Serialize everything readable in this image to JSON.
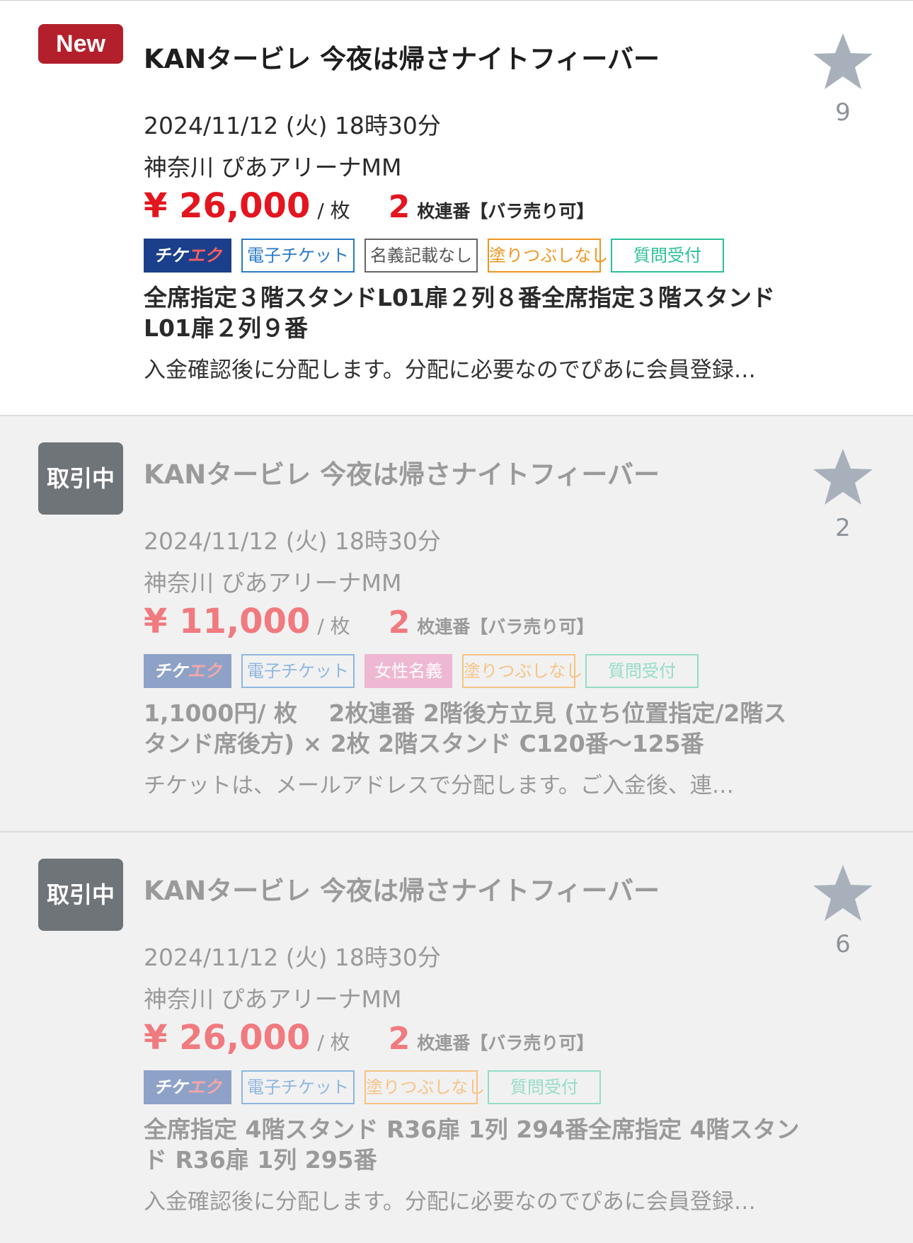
{
  "listings": [
    {
      "status": "New",
      "title": "KANタービレ 今夜は帰さナイトフィーバー",
      "date": "2024/11/12 (火) 18時30分",
      "venue": "神奈川 ぴあアリーナMM",
      "price": "¥ 26,000",
      "per": "/ 枚",
      "qty": "2",
      "qty_label": "枚連番【バラ売り可】",
      "tags": {
        "ticket_prefix": "チケ",
        "ticket_accent": "エク",
        "etix": "電子チケット",
        "noname": "名義記載なし",
        "nopaint": "塗りつぶしなし",
        "qa": "質問受付"
      },
      "seat": "全席指定３階スタンドL01扉２列８番全席指定３階スタンドL01扉２列９番",
      "note": "入金確認後に分配します。分配に必要なのでぴあに会員登録…",
      "favorites": "9"
    },
    {
      "status": "取引中",
      "title": "KANタービレ 今夜は帰さナイトフィーバー",
      "date": "2024/11/12 (火) 18時30分",
      "venue": "神奈川 ぴあアリーナMM",
      "price": "¥ 11,000",
      "per": "/ 枚",
      "qty": "2",
      "qty_label": "枚連番【バラ売り可】",
      "tags": {
        "ticket_prefix": "チケ",
        "ticket_accent": "エク",
        "etix": "電子チケット",
        "female": "女性名義",
        "nopaint": "塗りつぶしなし",
        "qa": "質問受付"
      },
      "seat": "1,1000円/ 枚　 2枚連番 2階後方立見 (立ち位置指定/2階スタンド席後方) × 2枚 2階スタンド C120番〜125番",
      "note": "チケットは、メールアドレスで分配します。ご入金後、連…",
      "favorites": "2"
    },
    {
      "status": "取引中",
      "title": "KANタービレ 今夜は帰さナイトフィーバー",
      "date": "2024/11/12 (火) 18時30分",
      "venue": "神奈川 ぴあアリーナMM",
      "price": "¥ 26,000",
      "per": "/ 枚",
      "qty": "2",
      "qty_label": "枚連番【バラ売り可】",
      "tags": {
        "ticket_prefix": "チケ",
        "ticket_accent": "エク",
        "etix": "電子チケット",
        "nopaint": "塗りつぶしなし",
        "qa": "質問受付"
      },
      "seat": "全席指定 4階スタンド R36扉 1列 294番全席指定 4階スタンド R36扉 1列 295番",
      "note": "入金確認後に分配します。分配に必要なのでぴあに会員登録…",
      "favorites": "6"
    }
  ]
}
